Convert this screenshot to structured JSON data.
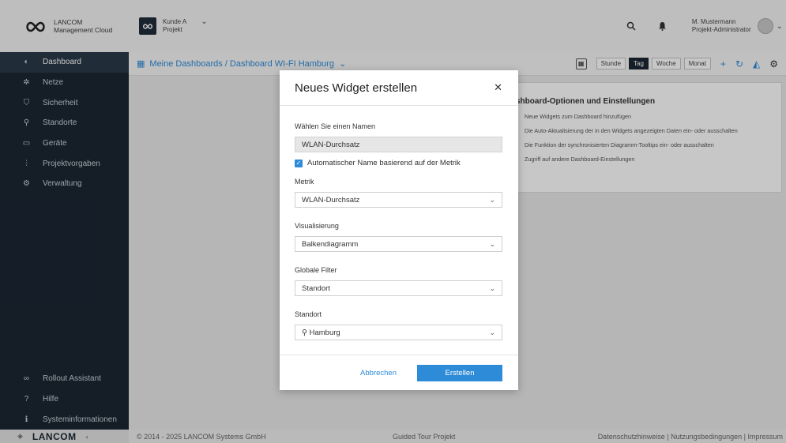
{
  "brand": {
    "line1": "LANCOM",
    "line2": "Management Cloud"
  },
  "customer": {
    "name": "Kunde A",
    "sub": "Projekt"
  },
  "user": {
    "name": "M. Mustermann",
    "role": "Projekt-Administrator"
  },
  "sidebar": {
    "items": [
      {
        "label": "Dashboard",
        "icon": "dashboard-icon"
      },
      {
        "label": "Netze",
        "icon": "network-icon"
      },
      {
        "label": "Sicherheit",
        "icon": "shield-icon"
      },
      {
        "label": "Standorte",
        "icon": "location-icon"
      },
      {
        "label": "Geräte",
        "icon": "device-icon"
      },
      {
        "label": "Projektvorgaben",
        "icon": "sliders-icon"
      },
      {
        "label": "Verwaltung",
        "icon": "gears-icon"
      }
    ],
    "bottom": [
      {
        "label": "Rollout Assistant",
        "icon": "rollout-icon"
      },
      {
        "label": "Hilfe",
        "icon": "help-icon"
      },
      {
        "label": "Systeminformationen",
        "icon": "info-icon"
      }
    ]
  },
  "subbar": {
    "breadcrumb": "Meine Dashboards / Dashboard WI-FI Hamburg",
    "time": [
      "Stunde",
      "Tag",
      "Woche",
      "Monat"
    ],
    "selected_time": "Tag"
  },
  "bgcard": {
    "title": "shboard-Optionen und Einstellungen",
    "items": [
      "Neue Widgets zum Dashboard hinzufügen",
      "Die Auto-Aktualisierung der in den Widgets angezeigten Daten ein- oder ausschalten",
      "Die Funktion der synchronisierten Diagramm-Tooltips ein- oder ausschalten",
      "Zugriff auf andere Dashboard-Einstellungen"
    ]
  },
  "modal": {
    "title": "Neues Widget erstellen",
    "name_label": "Wählen Sie einen Namen",
    "name_value": "WLAN-Durchsatz",
    "auto_name_label": "Automatischer Name basierend auf der Metrik",
    "metric_label": "Metrik",
    "metric_value": "WLAN-Durchsatz",
    "viz_label": "Visualisierung",
    "viz_value": "Balkendiagramm",
    "filter_label": "Globale Filter",
    "filter_value": "Standort",
    "site_label": "Standort",
    "site_value": "Hamburg",
    "cancel": "Abbrechen",
    "create": "Erstellen"
  },
  "footer": {
    "brand": "LANCOM",
    "copyright": "© 2014 - 2025 LANCOM Systems GmbH",
    "tour": "Guided Tour Projekt",
    "links": "Datenschutzhinweise | Nutzungsbedingungen | Impressum"
  },
  "colors": {
    "accent": "#2e8bd8",
    "sidebar": "#1b2733"
  }
}
